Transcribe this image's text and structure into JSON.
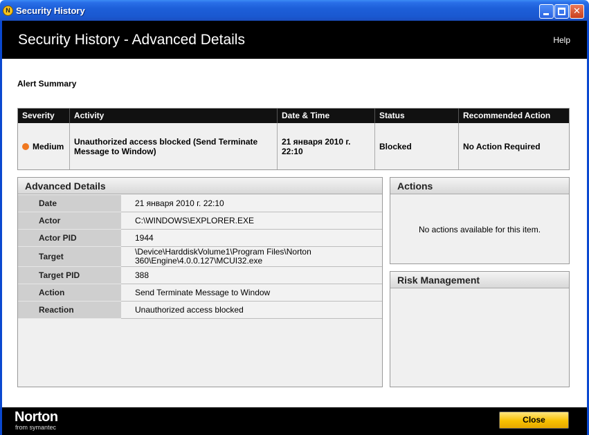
{
  "window": {
    "title": "Security History",
    "app_icon_glyph": "N",
    "controls": [
      "minimize",
      "maximize",
      "close"
    ]
  },
  "header": {
    "title": "Security History - Advanced Details",
    "help_label": "Help"
  },
  "alert_summary": {
    "label": "Alert Summary",
    "columns": [
      "Severity",
      "Activity",
      "Date & Time",
      "Status",
      "Recommended Action"
    ],
    "row": {
      "severity": "Medium",
      "severity_color": "#f07820",
      "activity": "Unauthorized access blocked (Send Terminate Message to Window)",
      "datetime": "21 января 2010 г. 22:10",
      "status": "Blocked",
      "recommended_action": "No Action Required"
    }
  },
  "advanced_details": {
    "title": "Advanced Details",
    "rows": [
      {
        "label": "Date",
        "value": "21 января 2010 г. 22:10"
      },
      {
        "label": "Actor",
        "value": "C:\\WINDOWS\\EXPLORER.EXE"
      },
      {
        "label": "Actor PID",
        "value": "1944"
      },
      {
        "label": "Target",
        "value": "\\Device\\HarddiskVolume1\\Program Files\\Norton 360\\Engine\\4.0.0.127\\MCUI32.exe"
      },
      {
        "label": "Target PID",
        "value": "388"
      },
      {
        "label": "Action",
        "value": "Send Terminate Message to Window"
      },
      {
        "label": "Reaction",
        "value": "Unauthorized access blocked"
      }
    ]
  },
  "actions": {
    "title": "Actions",
    "empty_text": "No actions available for this item."
  },
  "risk_management": {
    "title": "Risk Management"
  },
  "footer": {
    "brand": "Norton",
    "brand_sub": "from symantec",
    "close_label": "Close",
    "accent": "#f8c000"
  }
}
